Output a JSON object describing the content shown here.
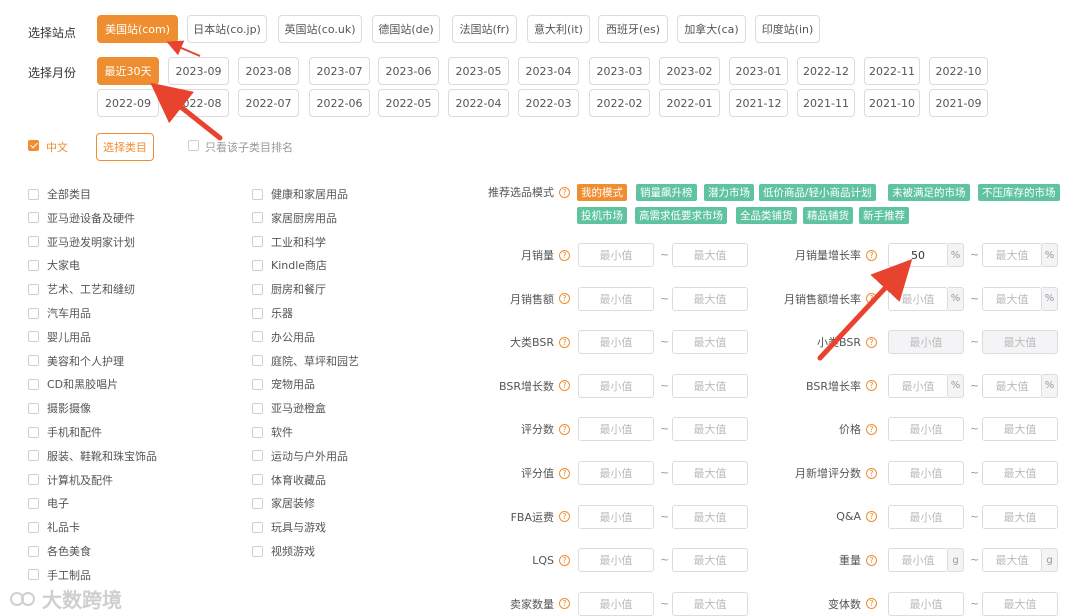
{
  "site_row": {
    "label": "选择站点",
    "options": [
      "美国站(com)",
      "日本站(co.jp)",
      "英国站(co.uk)",
      "德国站(de)",
      "法国站(fr)",
      "意大利(it)",
      "西班牙(es)",
      "加拿大(ca)",
      "印度站(in)"
    ]
  },
  "month_row": {
    "label": "选择月份",
    "row1": [
      "最近30天",
      "2023-09",
      "2023-08",
      "2023-07",
      "2023-06",
      "2023-05",
      "2023-04",
      "2023-03",
      "2023-02",
      "2023-01",
      "2022-12",
      "2022-11",
      "2022-10"
    ],
    "row2": [
      "2022-09",
      "2022-08",
      "2022-07",
      "2022-06",
      "2022-05",
      "2022-04",
      "2022-03",
      "2022-02",
      "2022-01",
      "2021-12",
      "2021-11",
      "2021-10",
      "2021-09"
    ]
  },
  "options": {
    "chinese_label": "中文",
    "select_category": "选择类目",
    "only_sub_rank": "只看该子类目排名"
  },
  "categories": {
    "col1": [
      "全部类目",
      "亚马逊设备及硬件",
      "亚马逊发明家计划",
      "大家电",
      "艺术、工艺和缝纫",
      "汽车用品",
      "婴儿用品",
      "美容和个人护理",
      "CD和黑胶唱片",
      "摄影摄像",
      "手机和配件",
      "服装、鞋靴和珠宝饰品",
      "计算机及配件",
      "电子",
      "礼品卡",
      "各色美食",
      "手工制品"
    ],
    "col2": [
      "健康和家居用品",
      "家居厨房用品",
      "工业和科学",
      "Kindle商店",
      "厨房和餐厅",
      "乐器",
      "办公用品",
      "庭院、草坪和园艺",
      "宠物用品",
      "亚马逊橙盒",
      "软件",
      "运动与户外用品",
      "体育收藏品",
      "家居装修",
      "玩具与游戏",
      "视频游戏"
    ]
  },
  "modes": {
    "label": "推荐选品模式",
    "tags_row1": [
      "我的模式",
      "销量飙升榜",
      "潜力市场",
      "低价商品/轻小商品计划",
      "未被满足的市场",
      "不压库存的市场"
    ],
    "tags_row2": [
      "投机市场",
      "高需求低要求市场",
      "全品类铺货",
      "精品铺货",
      "新手推荐"
    ]
  },
  "placeholders": {
    "min": "最小值",
    "max": "最大值",
    "tilde": "~"
  },
  "filters_left": [
    "月销量",
    "月销售额",
    "大类BSR",
    "BSR增长数",
    "评分数",
    "评分值",
    "FBA运费",
    "LQS",
    "卖家数量"
  ],
  "filters_right": [
    {
      "label": "月销量增长率",
      "min": "50",
      "suffix": "%"
    },
    {
      "label": "月销售额增长率",
      "min": "",
      "suffix": "%"
    },
    {
      "label": "小类BSR",
      "min": "",
      "suffix": ""
    },
    {
      "label": "BSR增长率",
      "min": "",
      "suffix": "%"
    },
    {
      "label": "价格",
      "min": "",
      "suffix": ""
    },
    {
      "label": "月新增评分数",
      "min": "",
      "suffix": ""
    },
    {
      "label": "Q&A",
      "min": "",
      "suffix": ""
    },
    {
      "label": "重量",
      "min": "",
      "suffix": "g"
    },
    {
      "label": "变体数",
      "min": "",
      "suffix": ""
    }
  ],
  "help_glyph": "?",
  "watermark": "大数跨境",
  "colors": {
    "accent": "#ef8e30",
    "tag_green": "#5fc3a0",
    "arrow": "#e8432e"
  }
}
